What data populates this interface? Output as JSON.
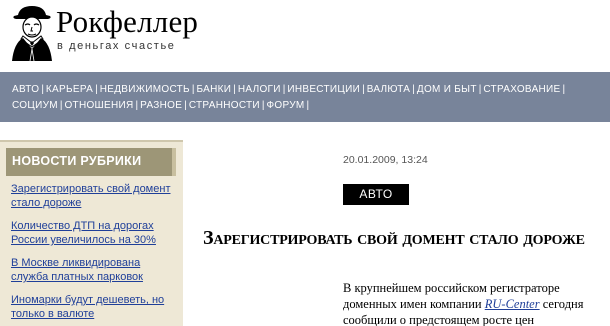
{
  "logo": {
    "title": "Рокфеллер",
    "slogan": "в деньгах счастье",
    "icon": "rockefeller-portrait-icon"
  },
  "nav": {
    "row1": [
      "АВТО",
      "КАРЬЕРА",
      "НЕДВИЖИМОСТЬ",
      "БАНКИ",
      "НАЛОГИ",
      "ИНВЕСТИЦИИ",
      "ВАЛЮТА",
      "ДОМ И БЫТ",
      "СТРАХОВАНИЕ"
    ],
    "row2": [
      "СОЦИУМ",
      "ОТНОШЕНИЯ",
      "РАЗНОЕ",
      "СТРАННОСТИ",
      "ФОРУМ"
    ],
    "separator": "|"
  },
  "sidebar": {
    "heading": "НОВОСТИ РУБРИКИ",
    "items": [
      "Зарегистрировать свой домент стало дороже",
      "Количество ДТП на дорогах России увеличилось на 30%",
      "В Москве ликвидирована служба платных парковок",
      "Иномарки будут дешеветь, но только в валюте"
    ]
  },
  "article": {
    "datetime": "20.01.2009, 13:24",
    "category": "АВТО",
    "title": "Зарегистрировать свой домент стало дороже",
    "body_before_link": "В крупнейшем российском регистраторе доменных имен компании ",
    "link_text": "RU-Center",
    "body_after_link": " сегодня сообщили о предстоящем росте цен"
  },
  "colors": {
    "nav_bg": "#78849a",
    "sidebar_bg": "#eee8d6",
    "sidebar_head_bg": "#9d9677",
    "link": "#1f3f99"
  }
}
